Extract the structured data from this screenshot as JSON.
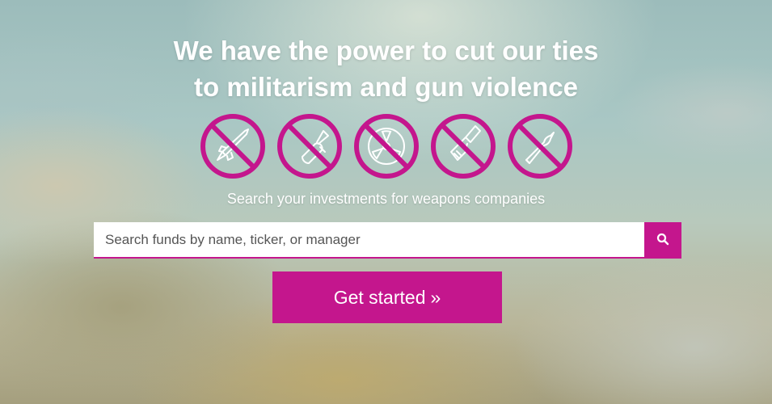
{
  "hero": {
    "headline_line1": "We have the power to cut our ties",
    "headline_line2": "to militarism and gun violence",
    "subtitle": "Search your investments for weapons companies"
  },
  "icons": [
    "no-missile-icon",
    "no-bomb-icon",
    "no-nuclear-icon",
    "no-handgun-icon",
    "no-bullet-icon"
  ],
  "search": {
    "placeholder": "Search funds by name, ticker, or manager",
    "value": "",
    "button_icon": "search-icon"
  },
  "cta": {
    "label": "Get started",
    "chevron": "»"
  },
  "colors": {
    "accent": "#c4168d",
    "text": "#ffffff"
  }
}
